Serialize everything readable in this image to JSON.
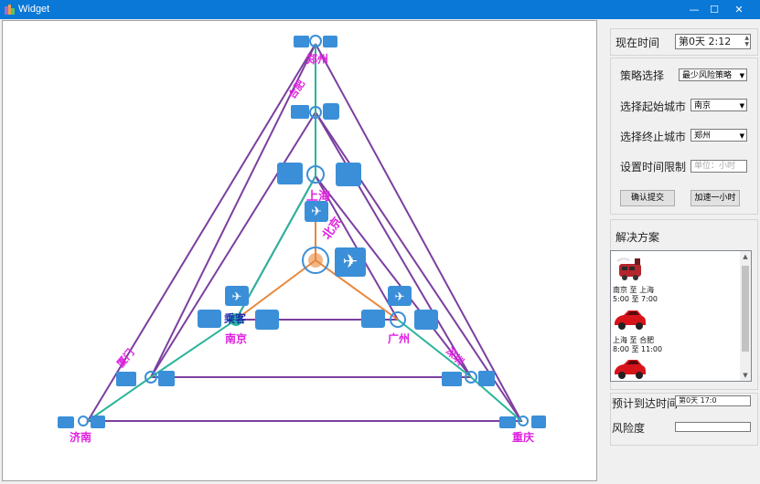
{
  "window": {
    "title": "Widget",
    "min_glyph": "—",
    "max_glyph": "☐",
    "close_glyph": "✕"
  },
  "graph": {
    "nodes": [
      {
        "id": "zhengzhou",
        "label": "郑州"
      },
      {
        "id": "hefei",
        "label": "合肥"
      },
      {
        "id": "shanghai",
        "label": "上海"
      },
      {
        "id": "beijing",
        "label": "北京"
      },
      {
        "id": "nanjing",
        "label": "南京"
      },
      {
        "id": "guangzhou",
        "label": "广州"
      },
      {
        "id": "xiamen",
        "label": "厦门"
      },
      {
        "id": "shenzhen",
        "label": "深圳"
      },
      {
        "id": "jinan",
        "label": "济南"
      },
      {
        "id": "chongqing",
        "label": "重庆"
      }
    ],
    "traveler_label": "乘客",
    "colors": {
      "outer": "#7b3fa0",
      "rail": "#2ab59a",
      "air": "#e8873a",
      "label": "#e020e0",
      "icon": "#3a8fd8"
    }
  },
  "controls": {
    "time_label": "现在时间",
    "time_value": "第0天  2:12",
    "strategy_label": "策略选择",
    "strategy_value": "最少风险策略",
    "start_label": "选择起始城市",
    "start_value": "南京",
    "end_label": "选择终止城市",
    "end_value": "郑州",
    "limit_label": "设置时间限制",
    "limit_placeholder": "单位：小时",
    "submit_label": "确认提交",
    "speed_label": "加速一小时"
  },
  "solution": {
    "title": "解决方案",
    "steps": [
      {
        "route": "南京  至  上海",
        "time": "5:00  至  7:00",
        "vehicle": "train-icon"
      },
      {
        "route": "上海  至  合肥",
        "time": "8:00  至  11:00",
        "vehicle": "car-icon"
      },
      {
        "vehicle": "car-icon"
      }
    ]
  },
  "eta": {
    "label": "预计到达时间",
    "value": "第0天  17:0"
  },
  "risk": {
    "label": "风险度",
    "value": ""
  }
}
